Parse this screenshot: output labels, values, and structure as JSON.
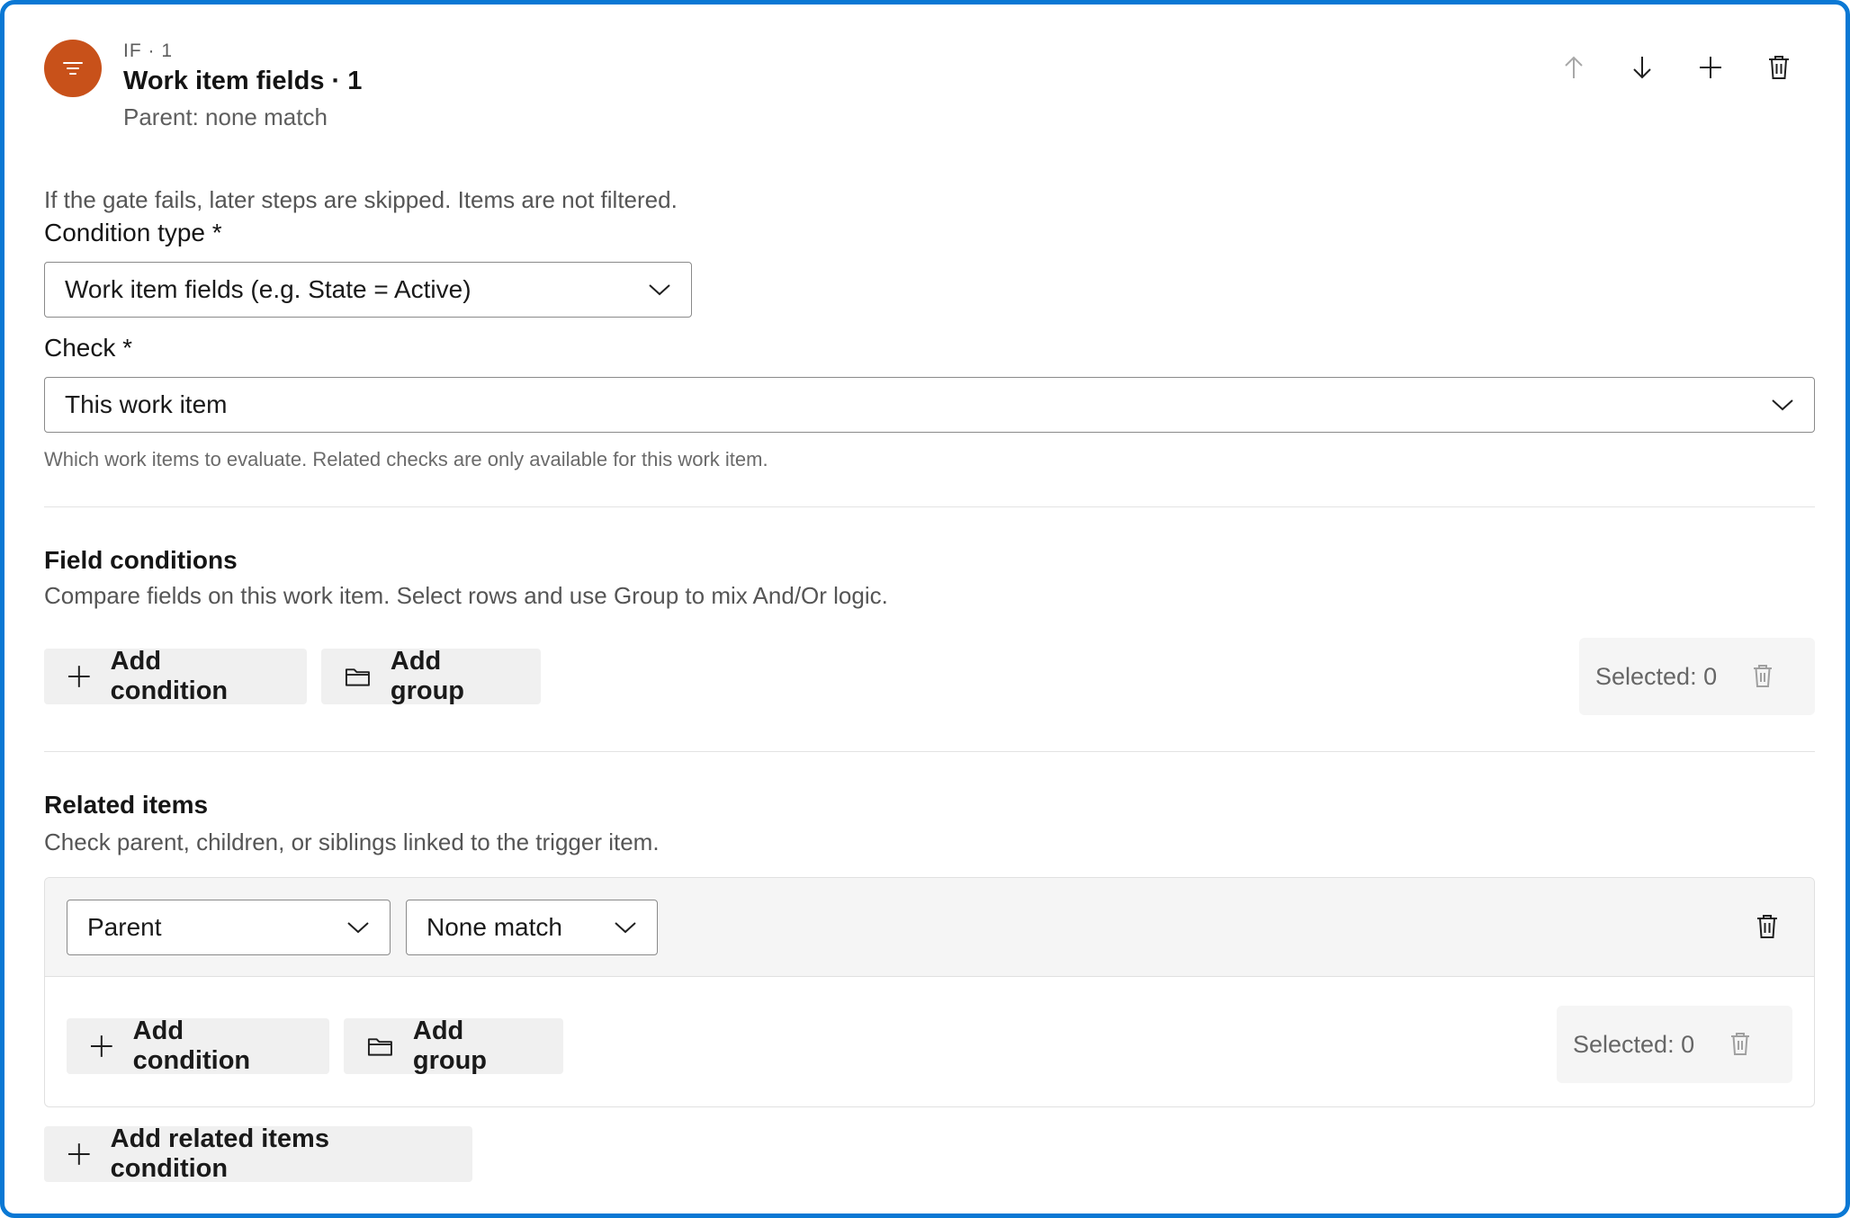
{
  "header": {
    "kicker": "IF · 1",
    "title": "Work item fields · 1",
    "subtitle": "Parent: none match",
    "icon": "filter-icon",
    "icon_color": "#c8511a"
  },
  "gate_note": "If the gate fails, later steps are skipped. Items are not filtered.",
  "condition_type": {
    "label": "Condition type *",
    "value": "Work item fields (e.g. State = Active)"
  },
  "check": {
    "label": "Check *",
    "value": "This work item",
    "hint": "Which work items to evaluate. Related checks are only available for this work item."
  },
  "field_conditions": {
    "title": "Field conditions",
    "description": "Compare fields on this work item. Select rows and use Group to mix And/Or logic.",
    "add_condition": "Add condition",
    "add_group": "Add group",
    "selected": "Selected: 0"
  },
  "related_items": {
    "title": "Related items",
    "description": "Check parent, children, or siblings linked to the trigger item.",
    "relation": "Parent",
    "match": "None match",
    "add_condition": "Add condition",
    "add_group": "Add group",
    "selected": "Selected: 0",
    "add_related": "Add related items condition"
  },
  "colors": {
    "accent_border": "#0a78d4",
    "icon_bg": "#c8511a"
  }
}
